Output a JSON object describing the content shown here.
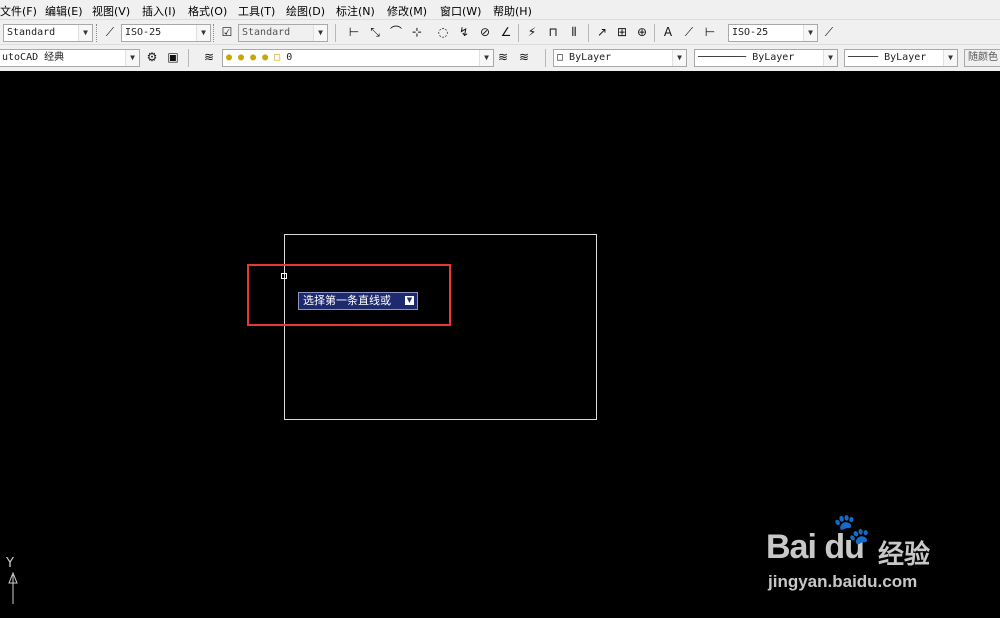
{
  "menu": {
    "items": [
      "文件(F)",
      "编辑(E)",
      "视图(V)",
      "插入(I)",
      "格式(O)",
      "工具(T)",
      "绘图(D)",
      "标注(N)",
      "修改(M)",
      "窗口(W)",
      "帮助(H)"
    ]
  },
  "toolbar1": {
    "text_style": "Standard",
    "dim_style": "ISO-25",
    "table_style": "Standard",
    "dim_style_right": "ISO-25"
  },
  "toolbar2": {
    "workspace": "utoCAD 经典",
    "layer": "0",
    "color": "ByLayer",
    "linetype": "ByLayer",
    "lineweight": "ByLayer",
    "plot_style": "随颜色"
  },
  "canvas": {
    "prompt_text": "选择第一条直线或",
    "ucs_label": "Y"
  },
  "watermark": {
    "logo": "Bai  du",
    "cn": "经验",
    "url": "jingyan.baidu.com"
  },
  "colors": {
    "highlight": "#e8392f",
    "prompt_bg": "#1e2a6e",
    "canvas": "#000000"
  }
}
